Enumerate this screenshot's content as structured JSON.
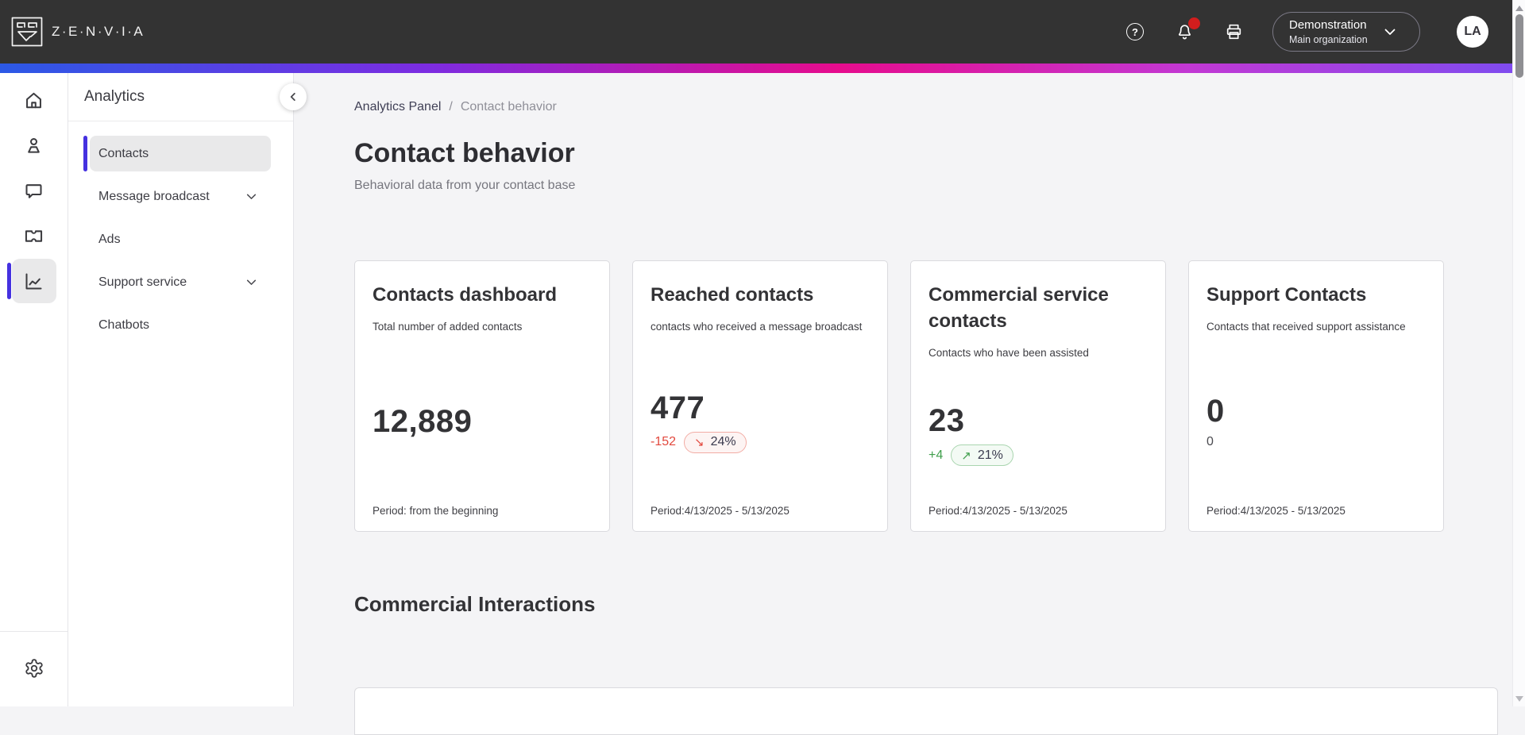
{
  "header": {
    "brand": "Z·E·N·V·I·A",
    "help_glyph": "?",
    "org": {
      "name": "Demonstration",
      "sub": "Main organization"
    },
    "avatar": "LA"
  },
  "sidebar": {
    "title": "Analytics",
    "items": [
      {
        "label": "Contacts"
      },
      {
        "label": "Message broadcast"
      },
      {
        "label": "Ads"
      },
      {
        "label": "Support service"
      },
      {
        "label": "Chatbots"
      }
    ]
  },
  "breadcrumb": {
    "parent": "Analytics Panel",
    "separator": "/",
    "current": "Contact behavior"
  },
  "page": {
    "title": "Contact behavior",
    "subtitle": "Behavioral data from your contact base"
  },
  "cards": [
    {
      "title": "Contacts dashboard",
      "subtitle": "Total number of added contacts",
      "value": "12,889",
      "period": "Period: from the beginning"
    },
    {
      "title": "Reached contacts",
      "subtitle": "contacts who received a message broadcast",
      "value": "477",
      "delta": "-152",
      "delta_pct": "24%",
      "trend": "down",
      "period": "Period:4/13/2025 - 5/13/2025"
    },
    {
      "title": "Commercial service contacts",
      "subtitle": "Contacts who have been assisted",
      "value": "23",
      "delta": "+4",
      "delta_pct": "21%",
      "trend": "up",
      "period": "Period:4/13/2025 - 5/13/2025"
    },
    {
      "title": "Support Contacts",
      "subtitle": "Contacts that received support assistance",
      "value": "0",
      "delta": "0",
      "period": "Period:4/13/2025 - 5/13/2025"
    }
  ],
  "section": {
    "title": "Commercial Interactions"
  },
  "icons": {
    "trend_down": "↘",
    "trend_up": "↗"
  },
  "colors": {
    "accent": "#4531e0",
    "header_bg": "#333333",
    "notification_dot": "#d21d1d",
    "negative": "#e2483d",
    "positive": "#3f9e4b",
    "gradient": [
      "#2b59e6",
      "#7c2ce2",
      "#e60c8d",
      "#c238d4",
      "#7d4cf0"
    ]
  }
}
